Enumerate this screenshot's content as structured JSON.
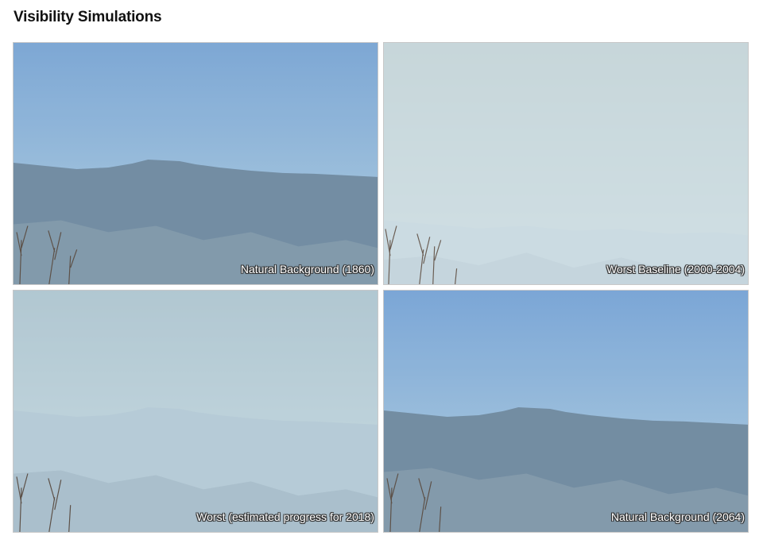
{
  "page": {
    "title": "Visibility Simulations"
  },
  "panels": [
    {
      "caption": "Natural Background (1860)",
      "sky_top": "#7aa5d3",
      "sky_bottom": "#b0cfe2",
      "ridge_color": "#6f8aa0",
      "lower_color": "#7f97a8",
      "haze_color": "#c9dbe3",
      "haze_opacity": 0.05
    },
    {
      "caption": "Worst Baseline (2000-2004)",
      "sky_top": "#a7b8b6",
      "sky_bottom": "#cbdbe0",
      "ridge_color": "#b8ccd6",
      "lower_color": "#9fb4c4",
      "haze_color": "#d2e0e5",
      "haze_opacity": 0.75
    },
    {
      "caption": "Worst (estimated progress for 2018)",
      "sky_top": "#9bb5c2",
      "sky_bottom": "#c3d7df",
      "ridge_color": "#a5bccc",
      "lower_color": "#8ea6b8",
      "haze_color": "#ccdde4",
      "haze_opacity": 0.45
    },
    {
      "caption": "Natural Background (2064)",
      "sky_top": "#78a4d5",
      "sky_bottom": "#b2d0e1",
      "ridge_color": "#6f899f",
      "lower_color": "#8097a8",
      "haze_color": "#c9dbe3",
      "haze_opacity": 0.05
    }
  ]
}
